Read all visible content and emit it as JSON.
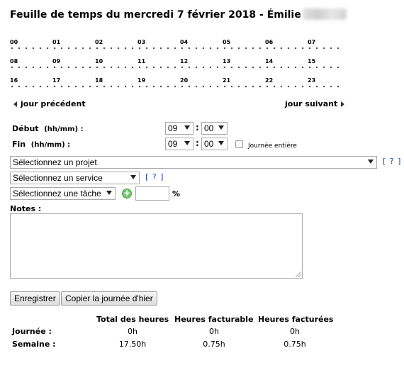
{
  "page": {
    "title": "Feuille de temps du mercredi 7 février 2018 - Émilie"
  },
  "hours": {
    "row1": [
      "00",
      "01",
      "02",
      "03",
      "04",
      "05",
      "06",
      "07"
    ],
    "row2": [
      "08",
      "09",
      "10",
      "11",
      "12",
      "13",
      "14",
      "15"
    ],
    "row3": [
      "16",
      "17",
      "18",
      "19",
      "20",
      "21",
      "22",
      "23"
    ]
  },
  "nav": {
    "prev": "jour précédent",
    "next": "jour suivant"
  },
  "form": {
    "start_label": "Début",
    "start_unit": "(hh/mm) :",
    "start_hour": "09",
    "start_minute": "00",
    "end_label": "Fin",
    "end_unit": "(hh/mm) :",
    "end_hour": "09",
    "end_minute": "00",
    "colon": ":",
    "full_day_label": "Journée entière",
    "project_select": "Sélectionnez un projet",
    "service_select": "Sélectionnez un service",
    "task_select": "Sélectionnez une tâche",
    "percent_value": "",
    "percent_sign": "%",
    "help": "[ ? ]",
    "notes_label": "Notes :",
    "notes_value": ""
  },
  "buttons": {
    "save": "Enregistrer",
    "copy": "Copier la journée d'hier"
  },
  "totals": {
    "headers": [
      "Total des heures",
      "Heures facturable",
      "Heures facturées"
    ],
    "rows": [
      {
        "label": "Journée :",
        "values": [
          "0h",
          "0h",
          "0h"
        ]
      },
      {
        "label": "Semaine :",
        "values": [
          "17.50h",
          "0.75h",
          "0.75h"
        ]
      }
    ]
  },
  "colors": {
    "link": "#1a3fbf",
    "add_icon": "#7ac470"
  }
}
